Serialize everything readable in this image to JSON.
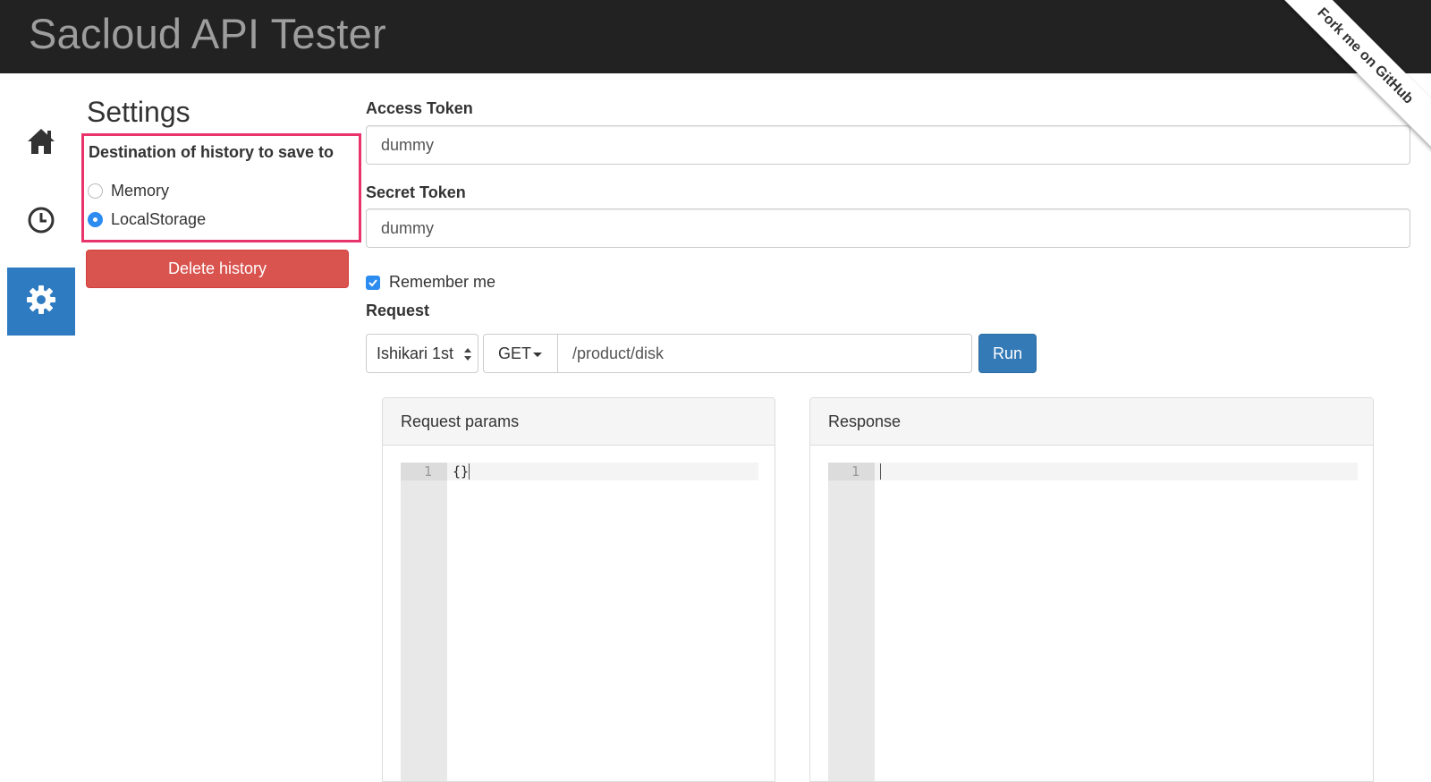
{
  "header": {
    "title": "Sacloud API Tester",
    "ribbon": "Fork me on GitHub"
  },
  "sidebar": {
    "items": [
      {
        "name": "home",
        "icon": "home-icon",
        "active": false
      },
      {
        "name": "history",
        "icon": "clock-icon",
        "active": false
      },
      {
        "name": "settings",
        "icon": "gear-icon",
        "active": true
      }
    ]
  },
  "settings": {
    "title": "Settings",
    "history_destination_label": "Destination of history to save to",
    "options": [
      "Memory",
      "LocalStorage"
    ],
    "selected": "LocalStorage",
    "delete_label": "Delete history"
  },
  "form": {
    "access_token_label": "Access Token",
    "access_token_value": "dummy",
    "secret_token_label": "Secret Token",
    "secret_token_value": "dummy",
    "remember_label": "Remember me",
    "remember_checked": true,
    "request_label": "Request",
    "region": "Ishikari 1st",
    "method": "GET",
    "path": "/product/disk",
    "run_label": "Run"
  },
  "panels": {
    "request_params": {
      "title": "Request params",
      "line_number": "1",
      "code": "{}"
    },
    "response": {
      "title": "Response",
      "line_number": "1",
      "code": ""
    }
  },
  "colors": {
    "navbar": "#222222",
    "accent": "#337ab7",
    "danger": "#d9534f",
    "highlight_border": "#e8336b",
    "sidebar_active": "#2f7bc1"
  }
}
